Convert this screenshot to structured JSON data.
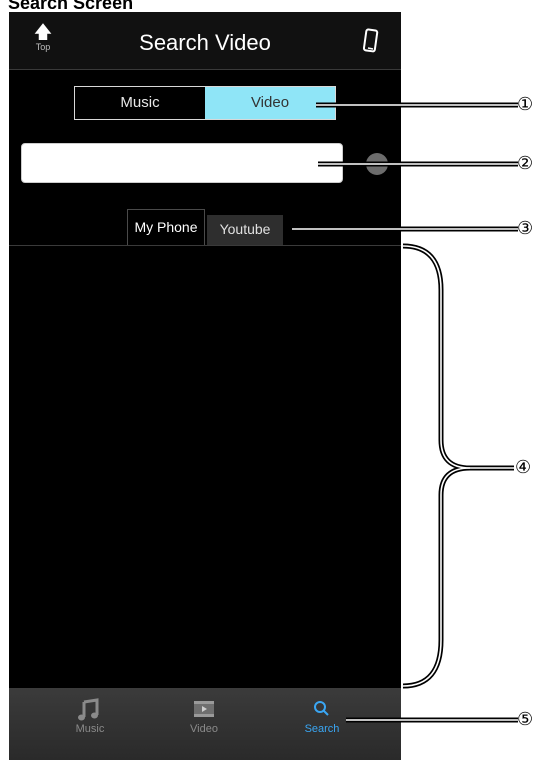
{
  "doc_title": "Search Screen",
  "navbar": {
    "top_arrow": "🡅",
    "top_label": "Top",
    "title": "Search Video"
  },
  "segment": {
    "music": "Music",
    "video": "Video",
    "selected": "Video"
  },
  "search": {
    "value": "",
    "placeholder": ""
  },
  "tabs": {
    "my_phone": "My Phone",
    "youtube": "Youtube",
    "active": "My Phone"
  },
  "tabbar": {
    "items": [
      {
        "label": "Music",
        "icon": "music-note-icon"
      },
      {
        "label": "Video",
        "icon": "film-icon"
      },
      {
        "label": "Search",
        "icon": "search-icon",
        "active": true
      }
    ]
  },
  "callouts": [
    "①",
    "②",
    "③",
    "④",
    "⑤"
  ],
  "colors": {
    "accent": "#8fe5f7",
    "active_tab": "#3aa6f3",
    "background": "#000000"
  }
}
